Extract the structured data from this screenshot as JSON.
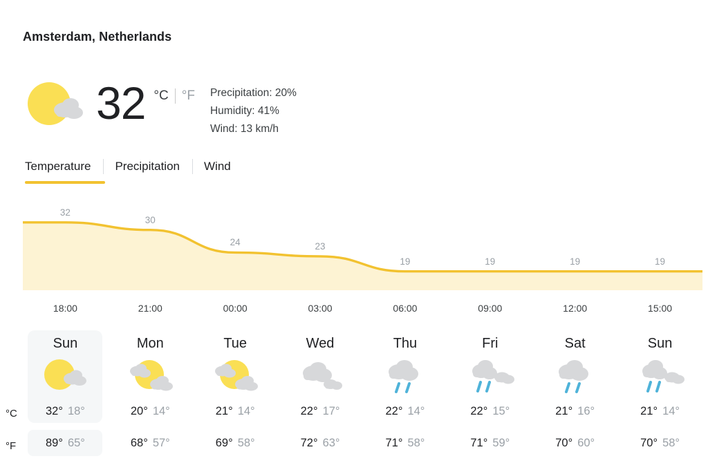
{
  "location": {
    "title": "Amsterdam, Netherlands"
  },
  "current": {
    "icon": "partly-sunny-icon",
    "temperature": "32",
    "unit_celsius": "°C",
    "unit_fahrenheit": "°F",
    "precipitation": "Precipitation: 20%",
    "humidity": "Humidity: 41%",
    "wind": "Wind: 13 km/h"
  },
  "tabs": [
    {
      "label": "Temperature",
      "active": true
    },
    {
      "label": "Precipitation",
      "active": false
    },
    {
      "label": "Wind",
      "active": false
    }
  ],
  "colors": {
    "accent": "#f2c230",
    "chart_line": "#f2c230",
    "chart_fill": "#fdf3d3",
    "muted_text": "#9aa0a6",
    "primary_text": "#202124",
    "card_active_bg": "#f5f7f8",
    "sun": "#fadf54",
    "cloud": "#d7d8da",
    "rain": "#4fb3d9"
  },
  "chart_data": {
    "type": "area",
    "title": "",
    "xlabel": "",
    "ylabel": "",
    "series": [
      {
        "name": "Temperature",
        "values": [
          32,
          30,
          24,
          23,
          19,
          19,
          19,
          19
        ]
      }
    ],
    "categories": [
      "18:00",
      "21:00",
      "00:00",
      "03:00",
      "06:00",
      "09:00",
      "12:00",
      "15:00"
    ],
    "point_labels": [
      "32",
      "30",
      "24",
      "23",
      "19",
      "19",
      "19",
      "19"
    ],
    "ylim": [
      14,
      36
    ],
    "grid": false,
    "legend": "none",
    "unit": "°C"
  },
  "time_axis": [
    "18:00",
    "21:00",
    "00:00",
    "03:00",
    "06:00",
    "09:00",
    "12:00",
    "15:00"
  ],
  "unit_rows": {
    "celsius_label": "°C",
    "fahrenheit_label": "°F"
  },
  "daily": [
    {
      "day": "Sun",
      "icon": "sunny-cloud-icon",
      "active": true,
      "c_high": "32°",
      "c_low": "18°",
      "f_high": "89°",
      "f_low": "65°"
    },
    {
      "day": "Mon",
      "icon": "partly-cloudy-icon",
      "active": false,
      "c_high": "20°",
      "c_low": "14°",
      "f_high": "68°",
      "f_low": "57°"
    },
    {
      "day": "Tue",
      "icon": "partly-cloudy-icon",
      "active": false,
      "c_high": "21°",
      "c_low": "14°",
      "f_high": "69°",
      "f_low": "58°"
    },
    {
      "day": "Wed",
      "icon": "cloudy-icon",
      "active": false,
      "c_high": "22°",
      "c_low": "17°",
      "f_high": "72°",
      "f_low": "63°"
    },
    {
      "day": "Thu",
      "icon": "rain-icon",
      "active": false,
      "c_high": "22°",
      "c_low": "14°",
      "f_high": "71°",
      "f_low": "58°"
    },
    {
      "day": "Fri",
      "icon": "rain-cloudy-icon",
      "active": false,
      "c_high": "22°",
      "c_low": "15°",
      "f_high": "71°",
      "f_low": "59°"
    },
    {
      "day": "Sat",
      "icon": "rain-icon",
      "active": false,
      "c_high": "21°",
      "c_low": "16°",
      "f_high": "70°",
      "f_low": "60°"
    },
    {
      "day": "Sun",
      "icon": "rain-cloudy-icon",
      "active": false,
      "c_high": "21°",
      "c_low": "14°",
      "f_high": "70°",
      "f_low": "58°"
    }
  ]
}
